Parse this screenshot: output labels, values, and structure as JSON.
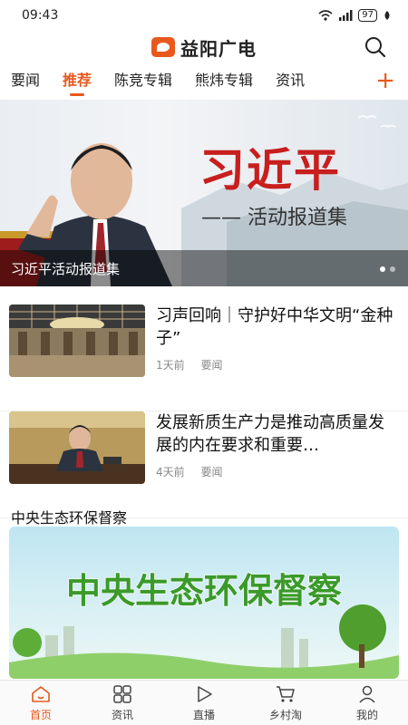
{
  "status_bar": {
    "time": "09:43",
    "battery": "97"
  },
  "header": {
    "app_name": "益阳广电"
  },
  "channel_tabs": [
    {
      "label": "要闻",
      "active": false
    },
    {
      "label": "推荐",
      "active": true
    },
    {
      "label": "陈竞专辑",
      "active": false
    },
    {
      "label": "熊炜专辑",
      "active": false
    },
    {
      "label": "资讯",
      "active": false
    }
  ],
  "add_tab_symbol": "+",
  "banner": {
    "headline": "习近平",
    "subtitle": "—— 活动报道集",
    "caption": "习近平活动报道集",
    "slides": 2,
    "active_slide": 1
  },
  "news": [
    {
      "title": "习声回响｜守护好中华文明“金种子”",
      "time": "1天前",
      "category": "要闻"
    },
    {
      "title": "发展新质生产力是推动高质量发展的内在要求和重要…",
      "time": "4天前",
      "category": "要闻"
    }
  ],
  "section": {
    "title": "中央生态环保督察",
    "promo_text": "中央生态环保督察"
  },
  "bottom_nav": [
    {
      "label": "首页",
      "icon": "home-icon",
      "active": true
    },
    {
      "label": "资讯",
      "icon": "grid-icon",
      "active": false
    },
    {
      "label": "直播",
      "icon": "play-icon",
      "active": false
    },
    {
      "label": "乡村淘",
      "icon": "cart-icon",
      "active": false
    },
    {
      "label": "我的",
      "icon": "user-icon",
      "active": false
    }
  ],
  "colors": {
    "accent": "#e8581c",
    "headline_red": "#c81e1e",
    "promo_green": "#3a9a2a"
  }
}
